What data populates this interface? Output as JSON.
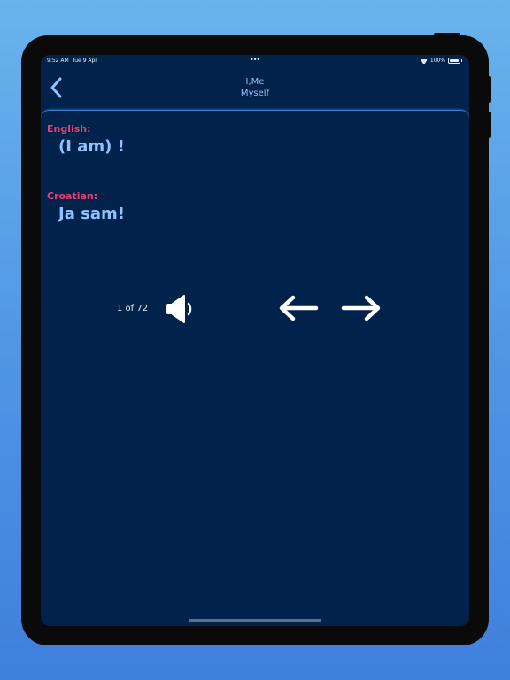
{
  "status_bar": {
    "time": "9:52 AM",
    "date": "Tue 9 Apr",
    "battery": "100%"
  },
  "nav": {
    "title_line1": "I,Me",
    "title_line2": "Myself"
  },
  "card": {
    "source_label": "English:",
    "source_phrase": "(I am) !",
    "target_label": "Croatian:",
    "target_phrase": "Ja sam!",
    "counter": "1 of 72"
  },
  "icons": [
    "back-chevron-icon",
    "speaker-icon",
    "arrow-left-icon",
    "arrow-right-icon",
    "wifi-icon",
    "battery-icon"
  ],
  "colors": {
    "background": "#01224b",
    "accent": "#8fc3ff",
    "label": "#ea3e6f"
  }
}
